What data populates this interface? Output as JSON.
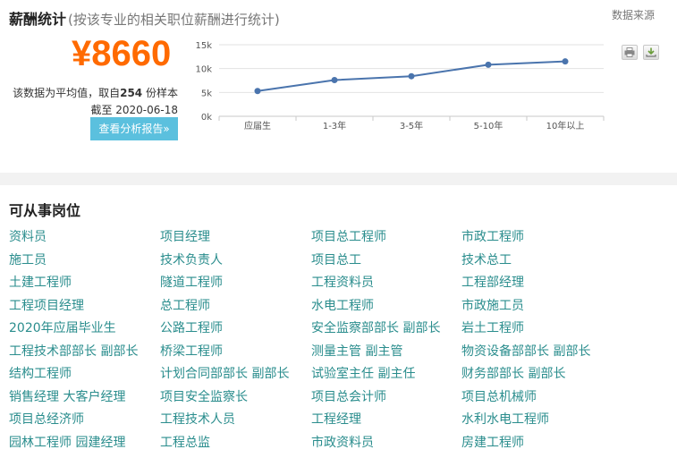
{
  "salary": {
    "title": "薪酬统计",
    "subtitle": "(按该专业的相关职位薪酬进行统计)",
    "source_link": "数据来源",
    "amount": "¥8660",
    "desc_prefix": "该数据为平均值，取自",
    "sample_count": "254",
    "desc_suffix": " 份样本",
    "date_line": "截至 2020-06-18",
    "report_button": "查看分析报告»"
  },
  "toolbar": {
    "print_icon": "print-icon",
    "download_icon": "download-icon"
  },
  "colors": {
    "accent_orange": "#ff6a00",
    "button_blue": "#5bc0de",
    "link_teal": "#2a8d8d",
    "line": "#4a74ad"
  },
  "chart_data": {
    "type": "line",
    "categories": [
      "应届生",
      "1-3年",
      "3-5年",
      "5-10年",
      "10年以上"
    ],
    "series": [
      {
        "values": [
          5300,
          7600,
          8400,
          10800,
          11500
        ]
      }
    ],
    "y_ticks": [
      "0k",
      "5k",
      "10k",
      "15k"
    ],
    "ylim": [
      0,
      15000
    ],
    "grid": true
  },
  "jobs": {
    "title": "可从事岗位",
    "items": [
      "资料员",
      "项目经理",
      "项目总工程师",
      "市政工程师",
      "施工员",
      "技术负责人",
      "项目总工",
      "技术总工",
      "土建工程师",
      "隧道工程师",
      "工程资料员",
      "工程部经理",
      "工程项目经理",
      "总工程师",
      "水电工程师",
      "市政施工员",
      "2020年应届毕业生",
      "公路工程师",
      "安全监察部部长 副部长",
      "岩土工程师",
      "工程技术部部长 副部长",
      "桥梁工程师",
      "测量主管 副主管",
      "物资设备部部长 副部长",
      "结构工程师",
      "计划合同部部长 副部长",
      "试验室主任 副主任",
      "财务部部长 副部长",
      "销售经理 大客户经理",
      "项目安全监察长",
      "项目总会计师",
      "项目总机械师",
      "项目总经济师",
      "工程技术人员",
      "工程经理",
      "水利水电工程师",
      "园林工程师 园建经理",
      "工程总监",
      "市政资料员",
      "房建工程师"
    ]
  }
}
